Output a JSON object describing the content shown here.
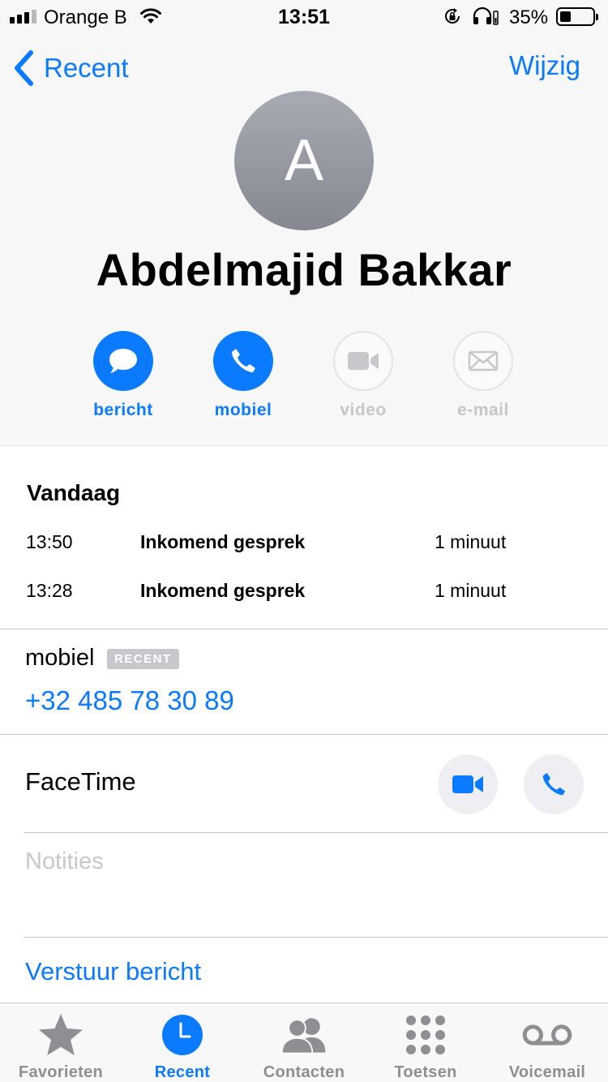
{
  "status_bar": {
    "carrier": "Orange B",
    "time": "13:51",
    "battery_percent": "35%",
    "battery_level": 0.35
  },
  "nav": {
    "back_label": "Recent",
    "edit_label": "Wijzig"
  },
  "contact": {
    "initial": "A",
    "name": "Abdelmajid Bakkar"
  },
  "actions": [
    {
      "label": "bericht",
      "icon": "message-icon",
      "enabled": true
    },
    {
      "label": "mobiel",
      "icon": "phone-icon",
      "enabled": true
    },
    {
      "label": "video",
      "icon": "video-icon",
      "enabled": false
    },
    {
      "label": "e-mail",
      "icon": "mail-icon",
      "enabled": false
    }
  ],
  "calls": {
    "section_title": "Vandaag",
    "items": [
      {
        "time": "13:50",
        "type": "Inkomend gesprek",
        "duration": "1 minuut"
      },
      {
        "time": "13:28",
        "type": "Inkomend gesprek",
        "duration": "1 minuut"
      }
    ]
  },
  "phone": {
    "label": "mobiel",
    "badge": "RECENT",
    "number": "+32 485 78 30 89"
  },
  "facetime": {
    "label": "FaceTime"
  },
  "notes": {
    "placeholder": "Notities"
  },
  "send_message": {
    "label": "Verstuur bericht"
  },
  "tab_bar": {
    "tabs": [
      {
        "label": "Favorieten",
        "icon": "star-icon",
        "active": false
      },
      {
        "label": "Recent",
        "icon": "clock-icon",
        "active": true
      },
      {
        "label": "Contacten",
        "icon": "contacts-icon",
        "active": false
      },
      {
        "label": "Toetsen",
        "icon": "keypad-icon",
        "active": false
      },
      {
        "label": "Voicemail",
        "icon": "voicemail-icon",
        "active": false
      }
    ]
  },
  "colors": {
    "accent": "#0a7aff",
    "inactive": "#8e8e93",
    "disabled": "#c6c6c8"
  }
}
